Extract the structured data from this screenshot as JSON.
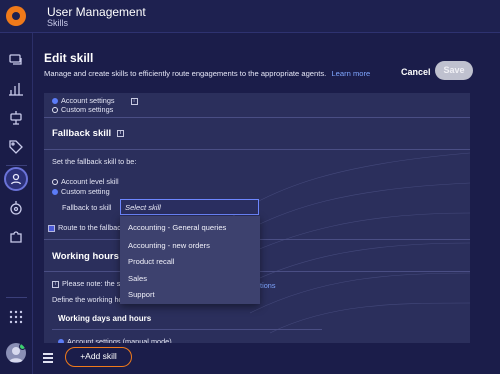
{
  "app": {
    "title": "User Management",
    "subtitle": "Skills"
  },
  "header": {
    "title": "Edit skill",
    "description": "Manage and create skills to efficiently route engagements to the appropriate agents.",
    "learn_more": "Learn more",
    "cancel_label": "Cancel",
    "save_label": "Save"
  },
  "form": {
    "account_settings": "Account settings",
    "custom_settings": "Custom settings",
    "fallback_title": "Fallback skill",
    "fallback_prompt": "Set the fallback skill to be:",
    "fallback_account_level": "Account level skill",
    "fallback_custom": "Custom setting",
    "fallback_to_label": "Fallback to skill",
    "fallback_placeholder": "Select skill",
    "route_fallback": "Route to the fallbac",
    "working_hours_title": "Working hours (",
    "note_prefix": "Please note: the s",
    "note_link": "ations",
    "working_desc": "Define the working hours and special occasions for this skill.",
    "working_days_title": "Working days and hours",
    "manual_mode": "Account settings (manual mode)"
  },
  "dropdown": {
    "options": [
      "Accounting - General queries",
      "Accounting - new orders",
      "Product recall",
      "Sales",
      "Support"
    ]
  },
  "footer": {
    "add_skill_label": "+Add skill"
  },
  "colors": {
    "accent": "#f07a1a",
    "primary": "#5c7cf7",
    "link": "#7fa6ff",
    "online": "#3bd16f"
  },
  "icons": [
    "logo-icon",
    "chat-icon",
    "chart-icon",
    "bot-icon",
    "tag-icon",
    "users-icon",
    "routing-icon",
    "puzzle-icon",
    "apps-grid-icon",
    "menu-icon",
    "info-icon"
  ]
}
